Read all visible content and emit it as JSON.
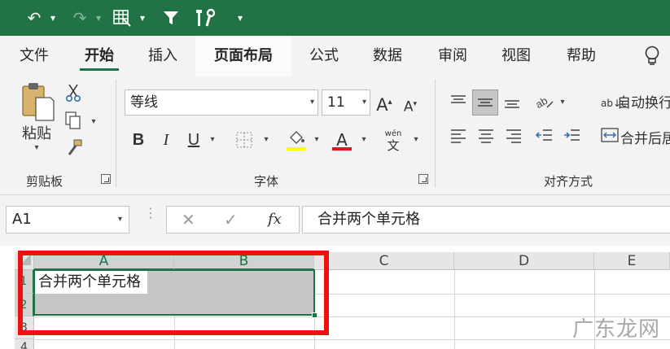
{
  "qat": {
    "undo_icon": "undo-icon",
    "redo_icon": "redo-icon",
    "table_icon": "table-format-icon",
    "filter_icon": "filter-icon",
    "tools_icon": "tools-icon",
    "customize_icon": "customize-qat-icon"
  },
  "tabs": [
    "文件",
    "开始",
    "插入",
    "页面布局",
    "公式",
    "数据",
    "审阅",
    "视图",
    "帮助"
  ],
  "active_tab": "开始",
  "ribbon": {
    "clipboard": {
      "paste_label": "粘贴",
      "group_label": "剪贴板"
    },
    "font": {
      "font_name": "等线",
      "font_size": "11",
      "bold": "B",
      "italic": "I",
      "underline": "U",
      "font_color_letter": "A",
      "grow_letter": "A",
      "shrink_letter": "A",
      "phonetic_top": "wén",
      "phonetic_bottom": "文",
      "group_label": "字体"
    },
    "alignment": {
      "wrap_text": "自动换行",
      "merge_center": "合并后居",
      "wrap_prefix": "ab↓c",
      "group_label": "对齐方式"
    }
  },
  "formula_bar": {
    "name_box": "A1",
    "cancel": "✕",
    "enter": "✓",
    "fx": "fx",
    "content": "合并两个单元格"
  },
  "sheet": {
    "columns": [
      "A",
      "B",
      "C",
      "D",
      "E"
    ],
    "rows": [
      "1",
      "2",
      "3",
      "4"
    ],
    "cell_A1": "合并两个单元格"
  },
  "watermark": "广东龙网",
  "colors": {
    "accent": "#217346",
    "highlight_red": "#ee1111",
    "font_color_bar": "#e81123",
    "fill_color_bar": "#ffff00"
  }
}
